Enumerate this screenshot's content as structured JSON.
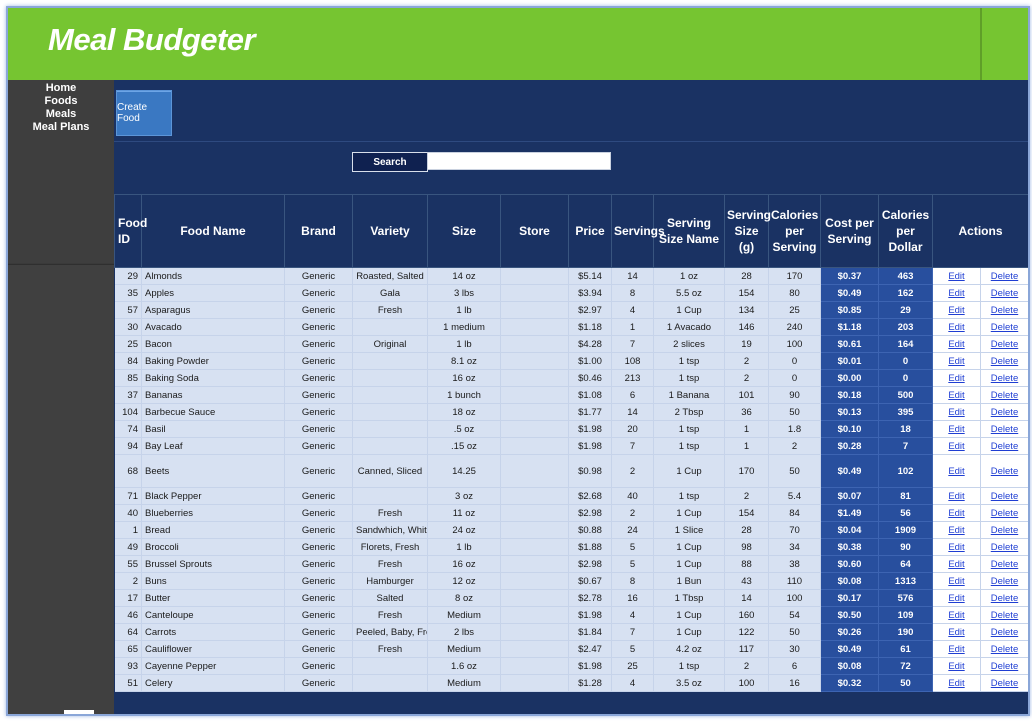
{
  "app": {
    "title": "Meal Budgeter"
  },
  "sidebar": {
    "items": [
      "Home",
      "Foods",
      "Meals",
      "Meal Plans"
    ]
  },
  "toolbar": {
    "create_label": "Create Food"
  },
  "search": {
    "label": "Search",
    "value": "",
    "placeholder": ""
  },
  "table": {
    "headers": [
      "Food ID",
      "Food Name",
      "Brand",
      "Variety",
      "Size",
      "Store",
      "Price",
      "Servings",
      "Serving Size Name",
      "Serving Size (g)",
      "Calories per Serving",
      "Cost per Serving",
      "Calories per Dollar",
      "Actions"
    ],
    "action_labels": {
      "edit": "Edit",
      "delete": "Delete"
    },
    "rows": [
      [
        "29",
        "Almonds",
        "Generic",
        "Roasted, Salted",
        "14 oz",
        "",
        "$5.14",
        "14",
        "1 oz",
        "28",
        "170",
        "$0.37",
        "463"
      ],
      [
        "35",
        "Apples",
        "Generic",
        "Gala",
        "3 lbs",
        "",
        "$3.94",
        "8",
        "5.5 oz",
        "154",
        "80",
        "$0.49",
        "162"
      ],
      [
        "57",
        "Asparagus",
        "Generic",
        "Fresh",
        "1 lb",
        "",
        "$2.97",
        "4",
        "1 Cup",
        "134",
        "25",
        "$0.85",
        "29"
      ],
      [
        "30",
        "Avacado",
        "Generic",
        "",
        "1 medium",
        "",
        "$1.18",
        "1",
        "1 Avacado",
        "146",
        "240",
        "$1.18",
        "203"
      ],
      [
        "25",
        "Bacon",
        "Generic",
        "Original",
        "1 lb",
        "",
        "$4.28",
        "7",
        "2 slices",
        "19",
        "100",
        "$0.61",
        "164"
      ],
      [
        "84",
        "Baking Powder",
        "Generic",
        "",
        "8.1 oz",
        "",
        "$1.00",
        "108",
        "1 tsp",
        "2",
        "0",
        "$0.01",
        "0"
      ],
      [
        "85",
        "Baking Soda",
        "Generic",
        "",
        "16 oz",
        "",
        "$0.46",
        "213",
        "1 tsp",
        "2",
        "0",
        "$0.00",
        "0"
      ],
      [
        "37",
        "Bananas",
        "Generic",
        "",
        "1 bunch",
        "",
        "$1.08",
        "6",
        "1 Banana",
        "101",
        "90",
        "$0.18",
        "500"
      ],
      [
        "104",
        "Barbecue Sauce",
        "Generic",
        "",
        "18 oz",
        "",
        "$1.77",
        "14",
        "2 Tbsp",
        "36",
        "50",
        "$0.13",
        "395"
      ],
      [
        "74",
        "Basil",
        "Generic",
        "",
        ".5 oz",
        "",
        "$1.98",
        "20",
        "1 tsp",
        "1",
        "1.8",
        "$0.10",
        "18"
      ],
      [
        "94",
        "Bay Leaf",
        "Generic",
        "",
        ".15 oz",
        "",
        "$1.98",
        "7",
        "1 tsp",
        "1",
        "2",
        "$0.28",
        "7"
      ],
      [
        "68",
        "Beets",
        "Generic",
        "Canned, Sliced",
        "14.25",
        "",
        "$0.98",
        "2",
        "1 Cup",
        "170",
        "50",
        "$0.49",
        "102"
      ],
      [
        "71",
        "Black Pepper",
        "Generic",
        "",
        "3 oz",
        "",
        "$2.68",
        "40",
        "1 tsp",
        "2",
        "5.4",
        "$0.07",
        "81"
      ],
      [
        "40",
        "Blueberries",
        "Generic",
        "Fresh",
        "11 oz",
        "",
        "$2.98",
        "2",
        "1 Cup",
        "154",
        "84",
        "$1.49",
        "56"
      ],
      [
        "1",
        "Bread",
        "Generic",
        "Sandwhich, White",
        "24 oz",
        "",
        "$0.88",
        "24",
        "1 Slice",
        "28",
        "70",
        "$0.04",
        "1909"
      ],
      [
        "49",
        "Broccoli",
        "Generic",
        "Florets, Fresh",
        "1 lb",
        "",
        "$1.88",
        "5",
        "1 Cup",
        "98",
        "34",
        "$0.38",
        "90"
      ],
      [
        "55",
        "Brussel Sprouts",
        "Generic",
        "Fresh",
        "16 oz",
        "",
        "$2.98",
        "5",
        "1 Cup",
        "88",
        "38",
        "$0.60",
        "64"
      ],
      [
        "2",
        "Buns",
        "Generic",
        "Hamburger",
        "12 oz",
        "",
        "$0.67",
        "8",
        "1 Bun",
        "43",
        "110",
        "$0.08",
        "1313"
      ],
      [
        "17",
        "Butter",
        "Generic",
        "Salted",
        "8 oz",
        "",
        "$2.78",
        "16",
        "1 Tbsp",
        "14",
        "100",
        "$0.17",
        "576"
      ],
      [
        "46",
        "Canteloupe",
        "Generic",
        "Fresh",
        "Medium",
        "",
        "$1.98",
        "4",
        "1 Cup",
        "160",
        "54",
        "$0.50",
        "109"
      ],
      [
        "64",
        "Carrots",
        "Generic",
        "Peeled, Baby, Fresh",
        "2 lbs",
        "",
        "$1.84",
        "7",
        "1 Cup",
        "122",
        "50",
        "$0.26",
        "190"
      ],
      [
        "65",
        "Cauliflower",
        "Generic",
        "Fresh",
        "Medium",
        "",
        "$2.47",
        "5",
        "4.2 oz",
        "117",
        "30",
        "$0.49",
        "61"
      ],
      [
        "93",
        "Cayenne Pepper",
        "Generic",
        "",
        "1.6 oz",
        "",
        "$1.98",
        "25",
        "1 tsp",
        "2",
        "6",
        "$0.08",
        "72"
      ],
      [
        "51",
        "Celery",
        "Generic",
        "",
        "Medium",
        "",
        "$1.28",
        "4",
        "3.5 oz",
        "100",
        "16",
        "$0.32",
        "50"
      ]
    ]
  }
}
